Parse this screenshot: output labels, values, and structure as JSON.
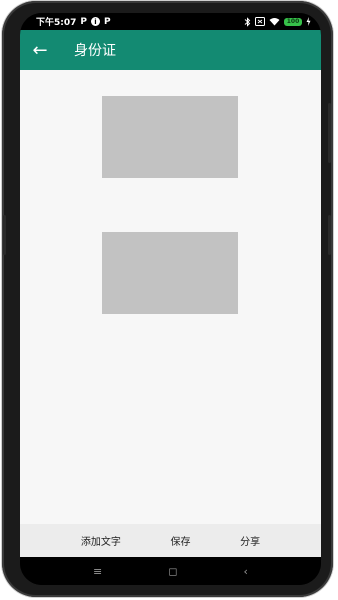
{
  "status_bar": {
    "time": "下午5:07",
    "left_icons": [
      "P",
      "i",
      "P"
    ],
    "battery": "100"
  },
  "app_bar": {
    "back_glyph": "←",
    "title": "身份证"
  },
  "bottom_actions": {
    "add_text": "添加文字",
    "save": "保存",
    "share": "分享"
  },
  "nav": {
    "menu": "≡",
    "home": "◻",
    "back": "‹"
  },
  "colors": {
    "accent": "#138a72",
    "placeholder": "#c2c2c2",
    "content_bg": "#f7f7f7",
    "bottom_bar_bg": "#ececec"
  }
}
